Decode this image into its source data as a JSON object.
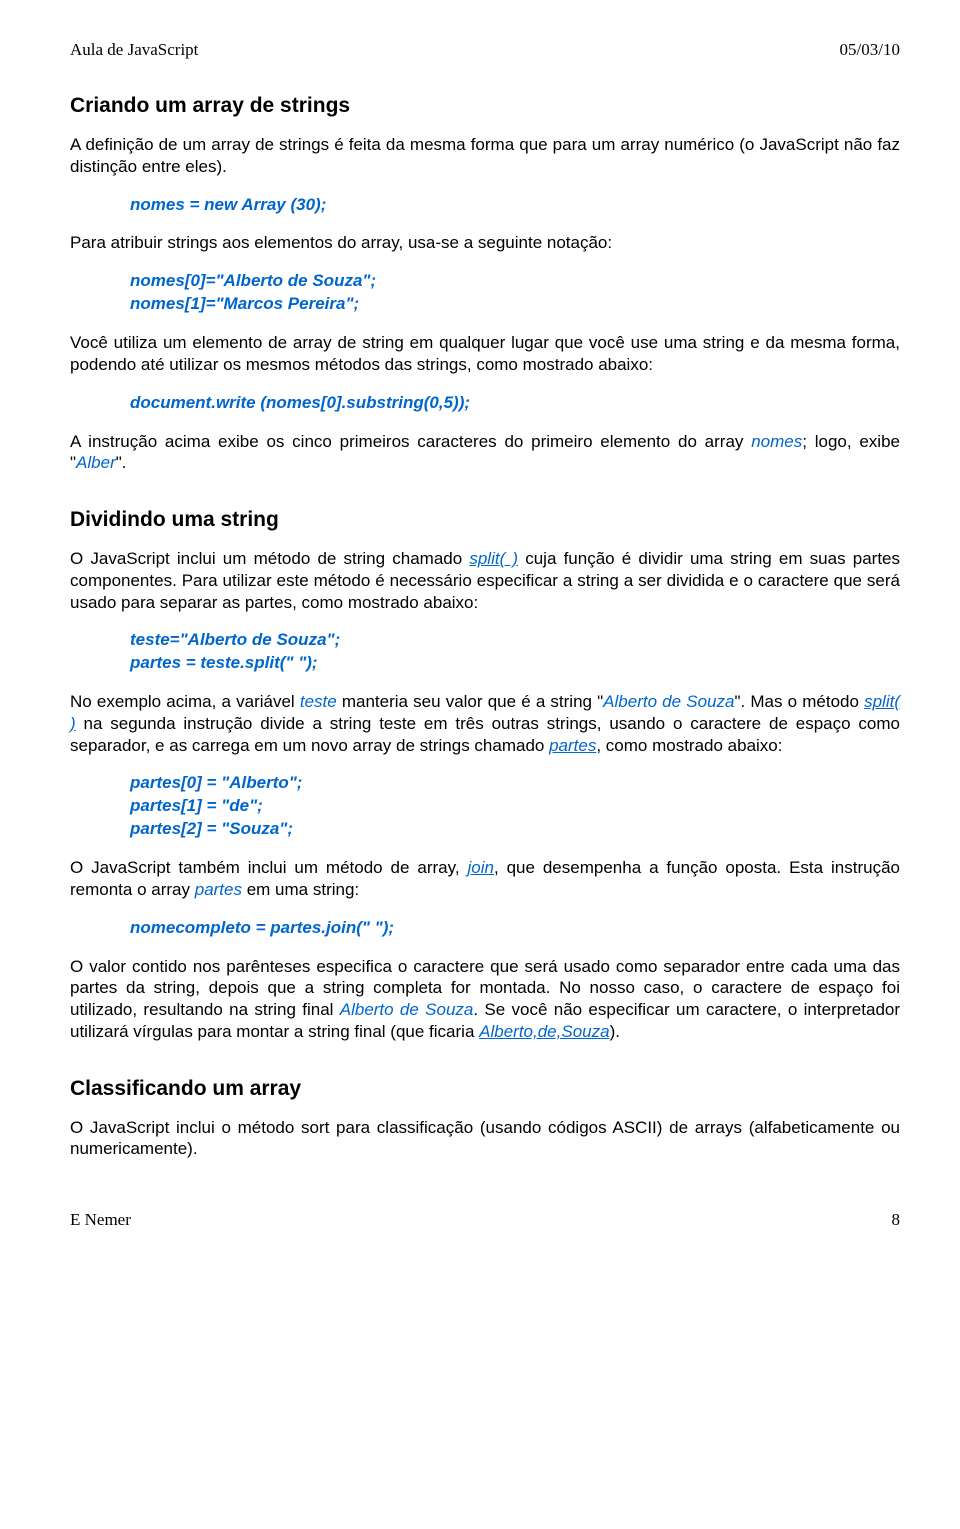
{
  "header": {
    "left": "Aula de JavaScript",
    "right": "05/03/10"
  },
  "footer": {
    "left": "E Nemer",
    "page": "8"
  },
  "sec1": {
    "title": "Criando um array de strings",
    "p1": "A definição de um array de strings é feita da mesma forma que para um array numérico (o JavaScript não faz distinção entre eles).",
    "code1": "nomes = new Array (30);",
    "p2": "Para atribuir strings aos elementos do array, usa-se a seguinte notação:",
    "code2a": "nomes[0]=\"Alberto de Souza\";",
    "code2b": "nomes[1]=\"Marcos Pereira\";",
    "p3": "Você utiliza um elemento de array de string em qualquer lugar que você use uma string e da mesma forma, podendo até utilizar os mesmos métodos das strings, como mostrado abaixo:",
    "code3": "document.write (nomes[0].substring(0,5));",
    "p4a": "A instrução acima exibe os cinco primeiros caracteres do primeiro elemento do array ",
    "p4b": "nomes",
    "p4c": "; logo, exibe \"",
    "p4d": "Alber",
    "p4e": "\"."
  },
  "sec2": {
    "title": "Dividindo uma string",
    "p1a": "O JavaScript inclui um método de string chamado ",
    "p1b": "split( )",
    "p1c": " cuja função é dividir uma string em suas partes componentes. Para utilizar este método é necessário especificar a string a ser dividida e o caractere que será usado para separar as partes, como mostrado abaixo:",
    "code1a": "teste=\"Alberto de Souza\";",
    "code1b": "partes = teste.split(\" \");",
    "p2a": "No exemplo acima, a variável ",
    "p2b": "teste",
    "p2c": " manteria seu valor que é a string \"",
    "p2d": "Alberto de Souza",
    "p2e": "\". Mas o método ",
    "p2f": "split( )",
    "p2g": " na segunda instrução divide a string teste em três outras strings, usando o caractere de espaço como separador, e as carrega em um novo array de strings chamado ",
    "p2h": "partes",
    "p2i": ", como mostrado abaixo:",
    "code2a": "partes[0] = \"Alberto\";",
    "code2b": "partes[1] = \"de\";",
    "code2c": "partes[2] = \"Souza\";",
    "p3a": "O JavaScript também inclui um método de array, ",
    "p3b": "join",
    "p3c": ", que desempenha a função oposta. Esta instrução remonta o array ",
    "p3d": "partes",
    "p3e": " em uma string:",
    "code3": "nomecompleto = partes.join(\" \");",
    "p4a": "O valor contido nos parênteses especifica o caractere que será usado como separador entre cada uma das partes da string, depois que a string completa for montada. No nosso caso, o caractere de espaço foi utilizado, resultando na string final ",
    "p4b": "Alberto de Souza",
    "p4c": ". Se você não especificar um caractere, o interpretador utilizará vírgulas para montar a string final (que ficaria ",
    "p4d": "Alberto,de,Souza",
    "p4e": ")."
  },
  "sec3": {
    "title": "Classificando um array",
    "p1": "O JavaScript inclui o método sort para classificação (usando códigos ASCII) de arrays (alfabeticamente ou numericamente)."
  }
}
